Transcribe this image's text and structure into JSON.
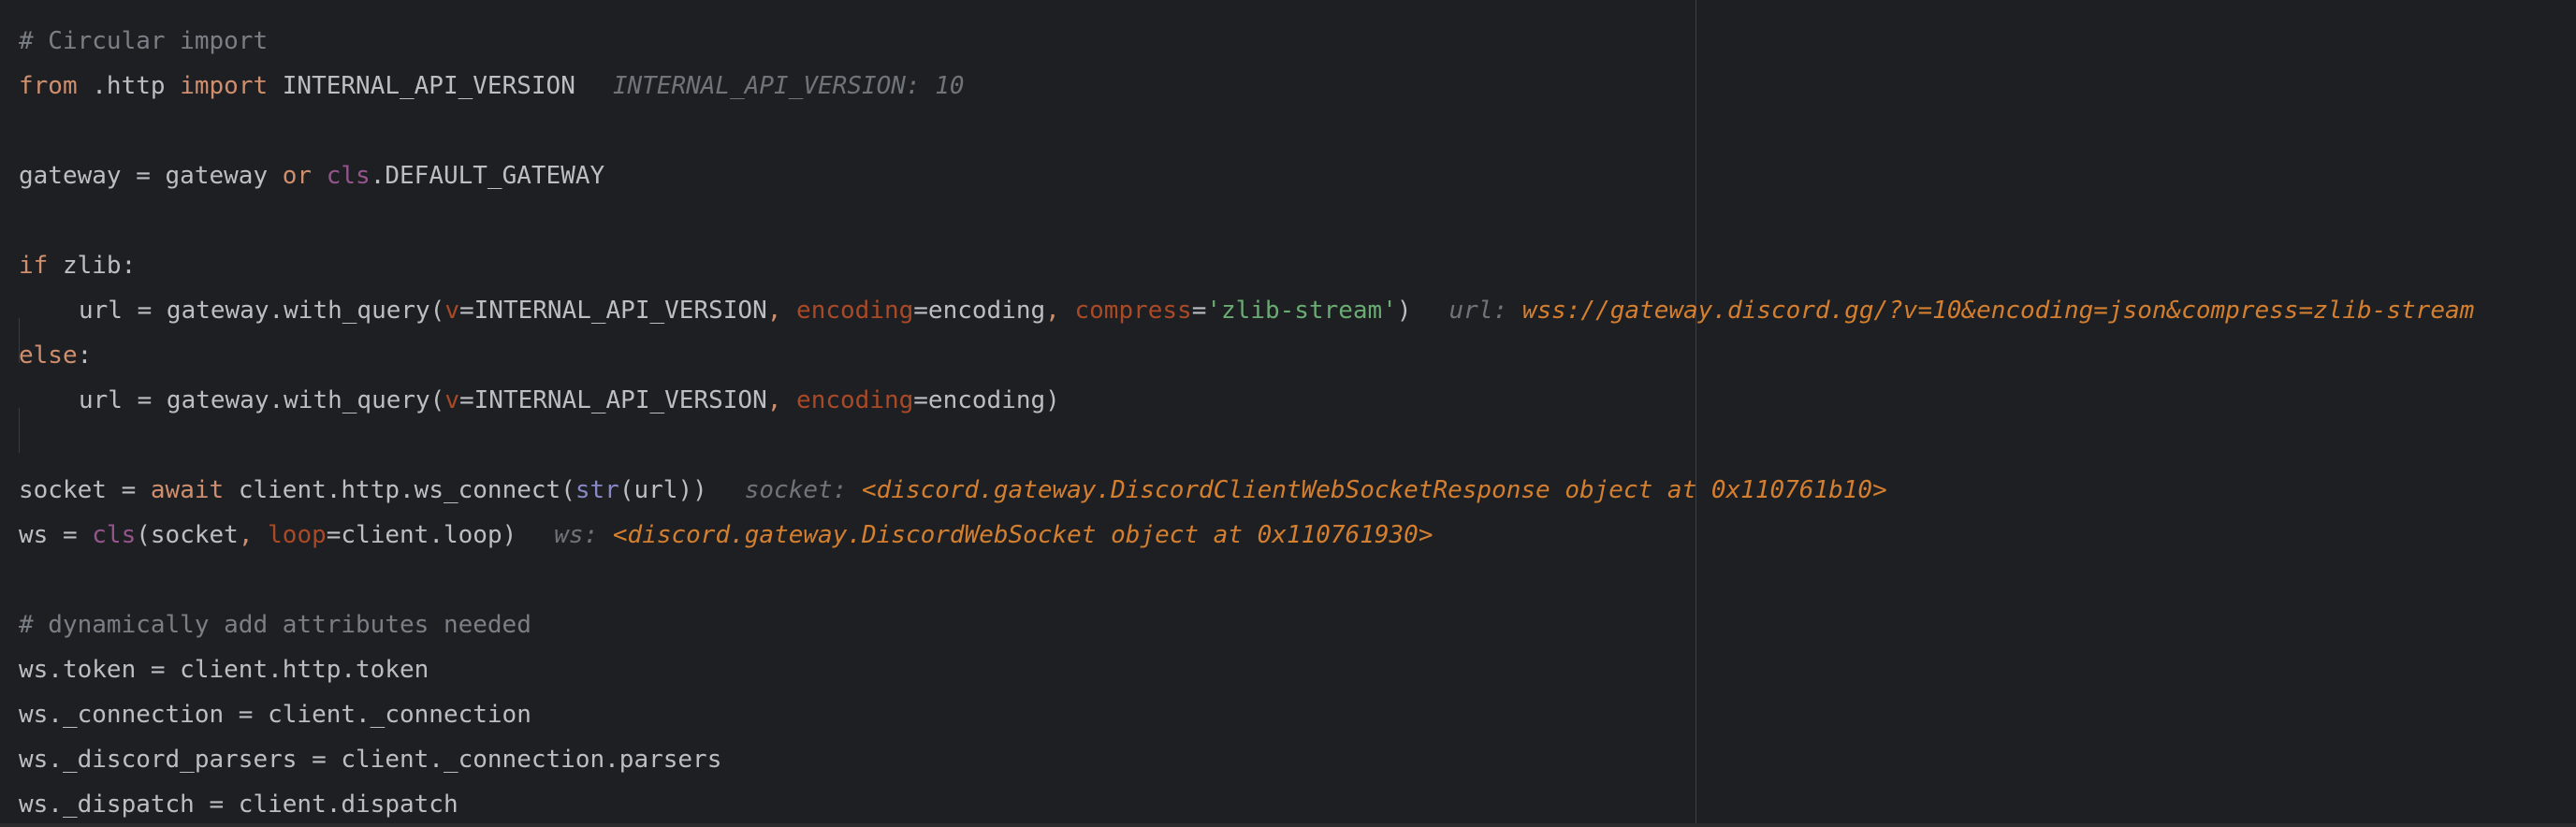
{
  "editor": {
    "lines": {
      "l1": {
        "comment": "# Circular import"
      },
      "l2": {
        "kw1": "from",
        "mod": " .http ",
        "kw2": "import",
        "name": " INTERNAL_API_VERSION",
        "hint_label": "INTERNAL_API_VERSION: 10"
      },
      "l4": {
        "a": "gateway = gateway ",
        "kw": "or",
        "sp": " ",
        "cls": "cls",
        "b": ".DEFAULT_GATEWAY"
      },
      "l6": {
        "kw": "if",
        "rest": " zlib:"
      },
      "l7": {
        "a": "url = gateway.with_query(",
        "p1": "v",
        "b": "=INTERNAL_API_VERSION",
        "c1": ", ",
        "p2": "encoding",
        "d": "=encoding",
        "c2": ", ",
        "p3": "compress",
        "e": "=",
        "str": "'zlib-stream'",
        "f": ")",
        "hint_label": "url: ",
        "hint_value": "wss://gateway.discord.gg/?v=10&encoding=json&compress=zlib-stream"
      },
      "l8": {
        "kw": "else",
        "rest": ":"
      },
      "l9": {
        "a": "url = gateway.with_query(",
        "p1": "v",
        "b": "=INTERNAL_API_VERSION",
        "c1": ", ",
        "p2": "encoding",
        "d": "=encoding)"
      },
      "l11": {
        "a": "socket = ",
        "kw": "await",
        "b": " client.http.ws_connect(",
        "builtin": "str",
        "c": "(url))",
        "hint_label": "socket: ",
        "hint_value": "<discord.gateway.DiscordClientWebSocketResponse object at 0x110761b10>"
      },
      "l12": {
        "a": "ws = ",
        "cls": "cls",
        "b": "(socket",
        "c1": ", ",
        "p1": "loop",
        "d": "=client.loop)",
        "hint_label": "ws: ",
        "hint_value": "<discord.gateway.DiscordWebSocket object at 0x110761930>"
      },
      "l14": {
        "comment": "# dynamically add attributes needed"
      },
      "l15": {
        "text": "ws.token = client.http.token"
      },
      "l16": {
        "text": "ws._connection = client._connection"
      },
      "l17": {
        "text": "ws._discord_parsers = client._connection.parsers"
      },
      "l18": {
        "text": "ws._dispatch = client.dispatch"
      }
    }
  },
  "colors": {
    "background": "#1e1f22",
    "keyword": "#cf8e6d",
    "self": "#94558d",
    "param": "#aa4926",
    "string": "#6aab73",
    "comment": "#7a7e85",
    "hint_value": "#d47f2f"
  }
}
